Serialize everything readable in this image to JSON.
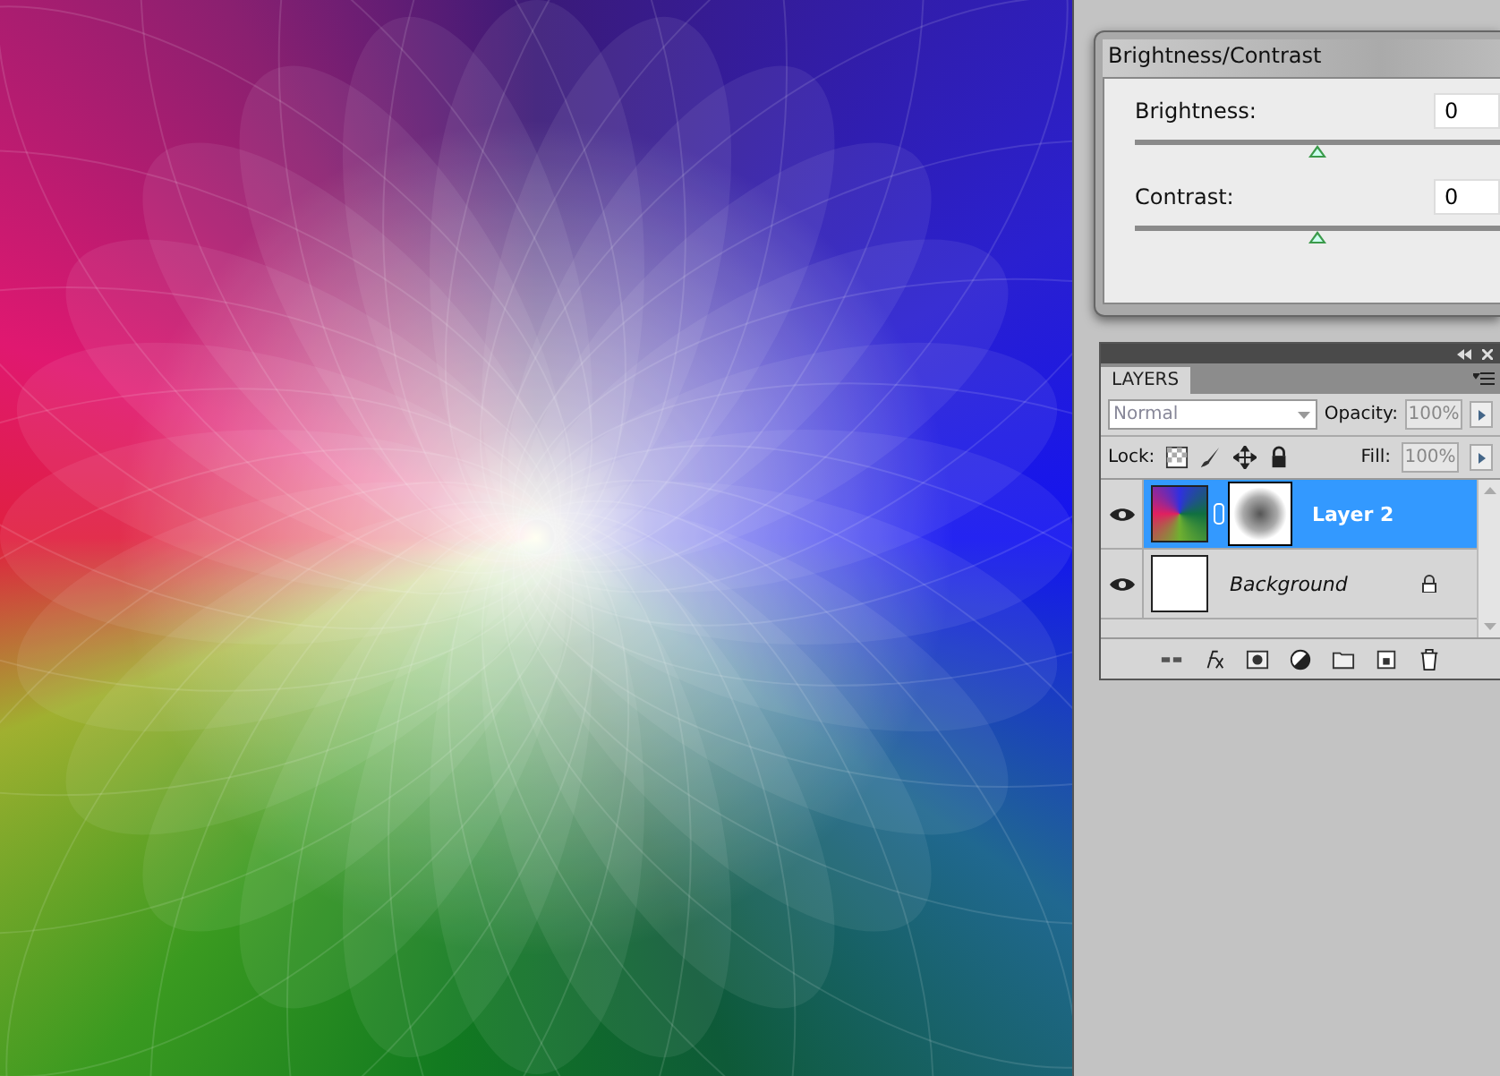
{
  "adjustment": {
    "title": "Brightness/Contrast",
    "sliders": [
      {
        "label": "Brightness:",
        "value": "0",
        "level": 0.5
      },
      {
        "label": "Contrast:",
        "value": "0",
        "level": 0.5
      }
    ]
  },
  "layers_panel": {
    "tab": "LAYERS",
    "blend_mode": "Normal",
    "opacity_label": "Opacity:",
    "opacity": "100%",
    "lock_label": "Lock:",
    "fill_label": "Fill:",
    "fill": "100%",
    "layers": [
      {
        "name": "Layer 2",
        "kind": "normal",
        "mask": true,
        "visible": true,
        "locked": false,
        "selected": true
      },
      {
        "name": "Background",
        "kind": "background",
        "mask": false,
        "visible": true,
        "locked": true,
        "selected": false
      }
    ]
  }
}
